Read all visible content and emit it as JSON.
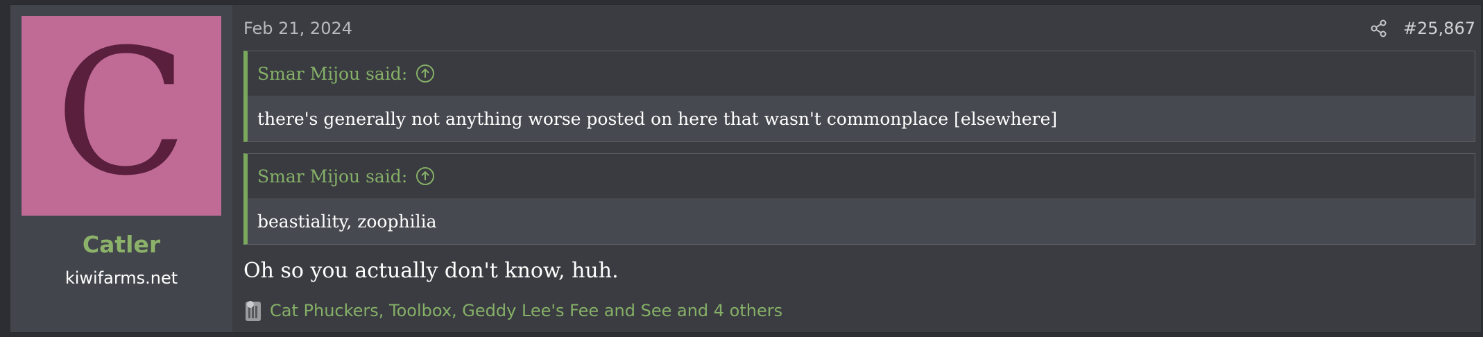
{
  "post": {
    "date": "Feb 21, 2024",
    "number": "#25,867",
    "share_icon": "share-icon",
    "message": "Oh so you actually don't know, huh."
  },
  "user": {
    "avatar_letter": "C",
    "avatar_bg": "#c06a96",
    "avatar_fg": "#5a1f3c",
    "name": "Catler",
    "title": "kiwifarms.net"
  },
  "quotes": [
    {
      "author_line": "Smar Mijou said:",
      "text": "there's generally not anything worse posted on here that wasn't commonplace [elsewhere]"
    },
    {
      "author_line": "Smar Mijou said:",
      "text": "beastiality, zoophilia"
    }
  ],
  "reactions": {
    "icon": "reaction-icon",
    "text": "Cat Phuckers, Toolbox, Geddy Lee's Fee and See and 4 others"
  },
  "colors": {
    "accent_green": "#86b067",
    "quote_border": "#7aa95d",
    "username": "#8cb26a"
  }
}
